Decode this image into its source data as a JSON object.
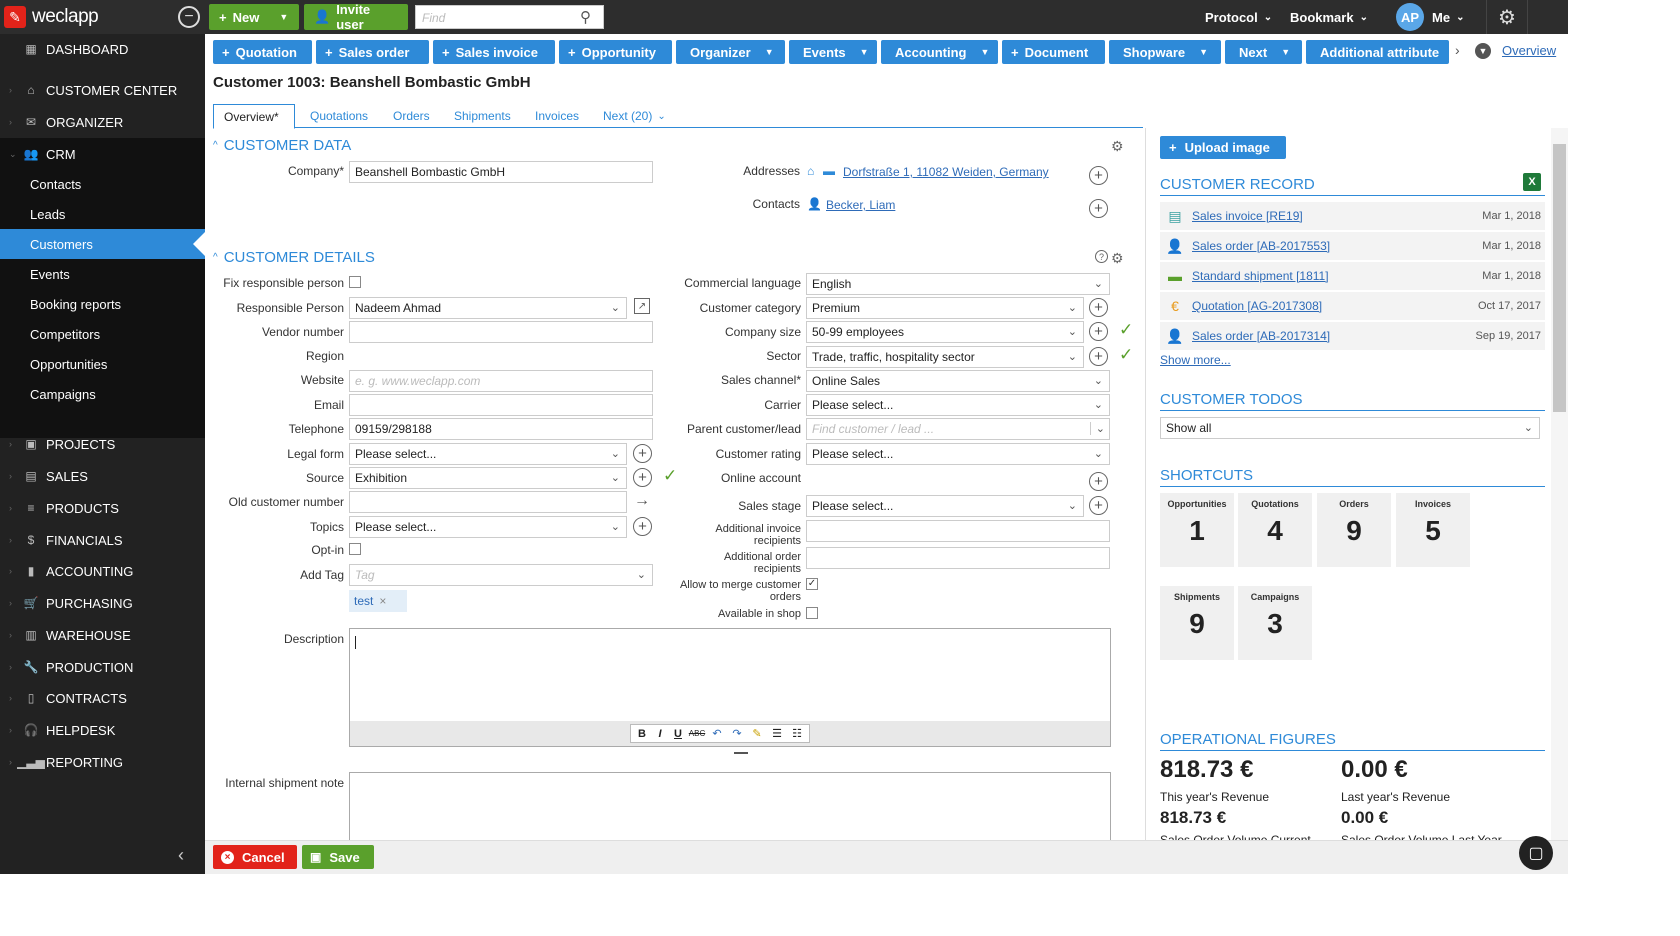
{
  "app": {
    "logo_text": "weclapp"
  },
  "top": {
    "new_label": "New",
    "invite_label": "Invite user",
    "find_placeholder": "Find",
    "protocol": "Protocol",
    "bookmark": "Bookmark",
    "avatar": "AP",
    "me": "Me"
  },
  "sidebar": {
    "dashboard": "DASHBOARD",
    "customer_center": "CUSTOMER CENTER",
    "organizer": "ORGANIZER",
    "crm": "CRM",
    "crm_items": [
      "Contacts",
      "Leads",
      "Customers",
      "Events",
      "Booking reports",
      "Competitors",
      "Opportunities",
      "Campaigns"
    ],
    "sections": [
      "PROJECTS",
      "SALES",
      "PRODUCTS",
      "FINANCIALS",
      "ACCOUNTING",
      "PURCHASING",
      "WAREHOUSE",
      "PRODUCTION",
      "CONTRACTS",
      "HELPDESK",
      "REPORTING"
    ]
  },
  "toolbar": {
    "buttons": [
      "Quotation",
      "Sales order",
      "Sales invoice",
      "Opportunity",
      "Organizer",
      "Events",
      "Accounting",
      "Document",
      "Shopware",
      "Next",
      "Additional attribute"
    ],
    "overview": "Overview"
  },
  "title": "Customer 1003: Beanshell Bombastic GmbH",
  "tabs": [
    "Overview*",
    "Quotations",
    "Orders",
    "Shipments",
    "Invoices",
    "Next (20)"
  ],
  "customer_data": {
    "heading": "CUSTOMER DATA",
    "company_label": "Company*",
    "company_value": "Beanshell Bombastic GmbH",
    "addresses_label": "Addresses",
    "address_value": "Dorfstraße 1, 11082 Weiden, Germany",
    "contacts_label": "Contacts",
    "contact_value": "Becker, Liam"
  },
  "customer_details": {
    "heading": "CUSTOMER DETAILS",
    "left": {
      "fix_responsible": "Fix responsible person",
      "responsible_label": "Responsible Person",
      "responsible_value": "Nadeem Ahmad",
      "vendor_label": "Vendor number",
      "region_label": "Region",
      "website_label": "Website",
      "website_placeholder": "e. g. www.weclapp.com",
      "email_label": "Email",
      "telephone_label": "Telephone",
      "telephone_value": "09159/298188",
      "legal_label": "Legal form",
      "legal_value": "Please select...",
      "source_label": "Source",
      "source_value": "Exhibition",
      "old_customer_label": "Old customer number",
      "topics_label": "Topics",
      "topics_value": "Please select...",
      "optin_label": "Opt-in",
      "tag_label": "Add Tag",
      "tag_placeholder": "Tag",
      "tag_chip": "test"
    },
    "right": {
      "language_label": "Commercial language",
      "language_value": "English",
      "category_label": "Customer category",
      "category_value": "Premium",
      "size_label": "Company size",
      "size_value": "50-99 employees",
      "sector_label": "Sector",
      "sector_value": "Trade, traffic, hospitality sector",
      "channel_label": "Sales channel*",
      "channel_value": "Online Sales",
      "carrier_label": "Carrier",
      "carrier_value": "Please select...",
      "parent_label": "Parent customer/lead",
      "parent_placeholder": "Find customer / lead ...",
      "rating_label": "Customer rating",
      "rating_value": "Please select...",
      "online_label": "Online account",
      "stage_label": "Sales stage",
      "stage_value": "Please select...",
      "add_invoice_label1": "Additional invoice",
      "add_invoice_label2": "recipients",
      "add_order_label1": "Additional order",
      "add_order_label2": "recipients",
      "merge_label1": "Allow to merge customer",
      "merge_label2": "orders",
      "shop_label": "Available in shop"
    },
    "description_label": "Description",
    "shipment_note_label": "Internal shipment note"
  },
  "right_panel": {
    "upload": "Upload image",
    "record_heading": "CUSTOMER RECORD",
    "records": [
      {
        "label": "Sales invoice [RE19]",
        "date": "Mar 1, 2018"
      },
      {
        "label": "Sales order [AB-2017553]",
        "date": "Mar 1, 2018"
      },
      {
        "label": "Standard shipment [1811]",
        "date": "Mar 1, 2018"
      },
      {
        "label": "Quotation [AG-2017308]",
        "date": "Oct 17, 2017"
      },
      {
        "label": "Sales order [AB-2017314]",
        "date": "Sep 19, 2017"
      }
    ],
    "show_more": "Show more...",
    "todos_heading": "CUSTOMER TODOS",
    "todos_value": "Show all",
    "shortcuts_heading": "SHORTCUTS",
    "tiles": [
      {
        "label": "Opportunities",
        "value": "1"
      },
      {
        "label": "Quotations",
        "value": "4"
      },
      {
        "label": "Orders",
        "value": "9"
      },
      {
        "label": "Invoices",
        "value": "5"
      },
      {
        "label": "Shipments",
        "value": "9"
      },
      {
        "label": "Campaigns",
        "value": "3"
      }
    ],
    "figures_heading": "OPERATIONAL FIGURES",
    "this_year": "818.73 €",
    "this_year_label": "This year's Revenue",
    "last_year": "0.00 €",
    "last_year_label": "Last year's Revenue",
    "so_current": "818.73 €",
    "so_current_label": "Sales Order Volume Current",
    "so_last": "0.00 €",
    "so_last_label": "Sales Order Volume Last Year"
  },
  "bottom": {
    "cancel": "Cancel",
    "save": "Save"
  }
}
